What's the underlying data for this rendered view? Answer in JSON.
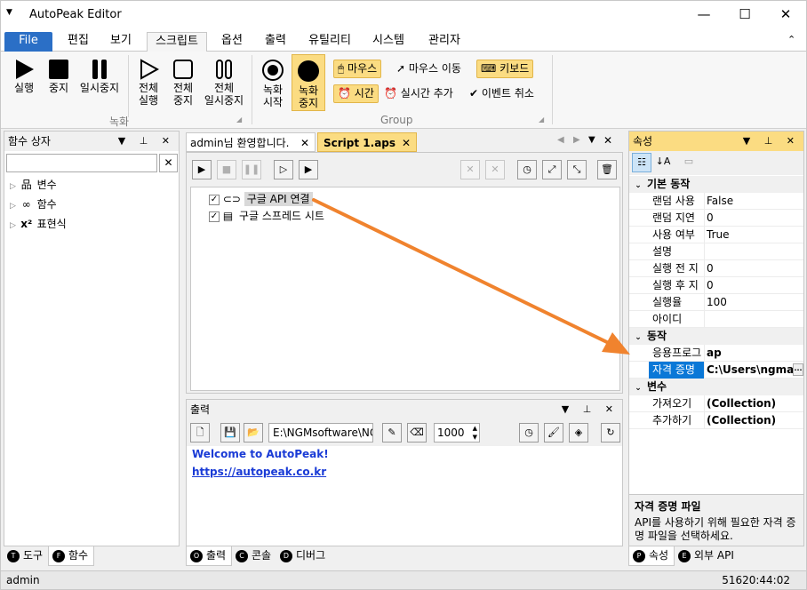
{
  "app": {
    "title": "AutoPeak Editor",
    "quick_access_icon": "dropdown-arrow-icon"
  },
  "menu": {
    "tabs": [
      "File",
      "편집",
      "보기",
      "스크립트",
      "옵션",
      "출력",
      "유틸리티",
      "시스템",
      "관리자"
    ],
    "active": "스크립트"
  },
  "ribbon": {
    "run": "실행",
    "stop": "중지",
    "pause": "일시중지",
    "run_all_1": "전체",
    "run_all_2": "실행",
    "stop_all_1": "전체",
    "stop_all_2": "중지",
    "pause_all_1": "전체",
    "pause_all_2": "일시중지",
    "record_start_1": "녹화",
    "record_start_2": "시작",
    "record_stop_1": "녹화",
    "record_stop_2": "중지",
    "group_record": "녹화",
    "mouse": "마우스",
    "mouse_move": "마우스 이동",
    "keyboard": "키보드",
    "time": "시간",
    "realtime_add": "실시간 추가",
    "event_cancel": "이벤트 취소",
    "group_group": "Group"
  },
  "function_box": {
    "title": "함수 상자",
    "search_value": "",
    "items": [
      "변수",
      "함수",
      "표현식"
    ],
    "bottom_tabs": [
      "도구",
      "함수"
    ],
    "bottom_tab_badges": [
      "T",
      "F"
    ]
  },
  "editor": {
    "tabs": [
      "admin님 환영합니다.",
      "Script 1.aps"
    ],
    "active_tab": "Script 1.aps",
    "tree": [
      {
        "label": "구글 API 연결",
        "checked": true,
        "icon": "link-icon"
      },
      {
        "label": "구글 스프레드 시트",
        "checked": true,
        "icon": "document-icon"
      }
    ]
  },
  "output": {
    "title": "출력",
    "path": "E:\\NGMsoftware\\NG",
    "number": "1000",
    "lines": [
      "Welcome to AutoPeak!",
      "https://autopeak.co.kr"
    ],
    "bottom_tabs": [
      "출력",
      "콘솔",
      "디버그"
    ],
    "bottom_tab_badges": [
      "O",
      "C",
      "D"
    ]
  },
  "properties": {
    "title": "속성",
    "categories": [
      {
        "name": "기본 동작",
        "rows": [
          {
            "name": "랜덤 사용",
            "value": "False"
          },
          {
            "name": "랜덤 지연",
            "value": "0"
          },
          {
            "name": "사용 여부",
            "value": "True"
          },
          {
            "name": "설명",
            "value": ""
          },
          {
            "name": "실행 전 지",
            "value": "0"
          },
          {
            "name": "실행 후 지",
            "value": "0"
          },
          {
            "name": "실행율",
            "value": "100"
          },
          {
            "name": "아이디",
            "value": ""
          }
        ]
      },
      {
        "name": "동작",
        "rows": [
          {
            "name": "응용프로그",
            "value": "ap"
          },
          {
            "name": "자격 증명",
            "value": "C:\\Users\\ngma"
          }
        ]
      },
      {
        "name": "변수",
        "rows": [
          {
            "name": "가져오기",
            "value": "(Collection)"
          },
          {
            "name": "추가하기",
            "value": "(Collection)"
          }
        ]
      }
    ],
    "selected_row": "자격 증명",
    "description_title": "자격 증명 파일",
    "description_text": "API를 사용하기 위해 필요한 자격 증명 파일을 선택하세요.",
    "bottom_tabs": [
      "속성",
      "외부 API"
    ],
    "bottom_tab_badges": [
      "P",
      "E"
    ]
  },
  "status": {
    "user": "admin",
    "time": "51620:44:02"
  },
  "colors": {
    "accent": "#2b6fc6",
    "highlight": "#fbdc82",
    "arrow": "#f0832e",
    "link": "#1a3bd6"
  }
}
